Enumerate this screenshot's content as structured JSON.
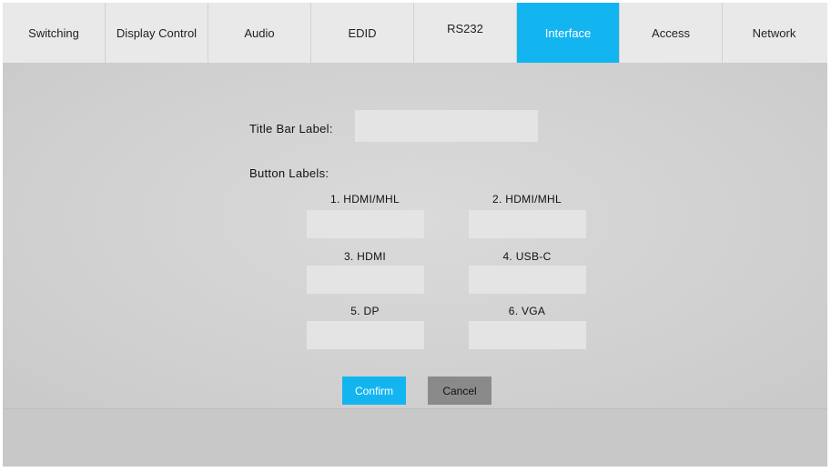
{
  "tabs": [
    {
      "label": "Switching"
    },
    {
      "label": "Display Control"
    },
    {
      "label": "Audio"
    },
    {
      "label": "EDID"
    },
    {
      "label": "RS232"
    },
    {
      "label": "Interface"
    },
    {
      "label": "Access"
    },
    {
      "label": "Network"
    }
  ],
  "active_tab": "Interface",
  "form": {
    "title_bar_label": "Title Bar Label:",
    "title_bar_value": "",
    "button_labels_heading": "Button Labels:",
    "buttons": [
      {
        "label": "1. HDMI/MHL",
        "value": ""
      },
      {
        "label": "2. HDMI/MHL",
        "value": ""
      },
      {
        "label": "3. HDMI",
        "value": ""
      },
      {
        "label": "4. USB-C",
        "value": ""
      },
      {
        "label": "5. DP",
        "value": ""
      },
      {
        "label": "6. VGA",
        "value": ""
      }
    ]
  },
  "actions": {
    "confirm_label": "Confirm",
    "cancel_label": "Cancel"
  },
  "colors": {
    "accent": "#13b5f0",
    "cancel": "#8a8a8a",
    "background": "#d3d3d3"
  }
}
